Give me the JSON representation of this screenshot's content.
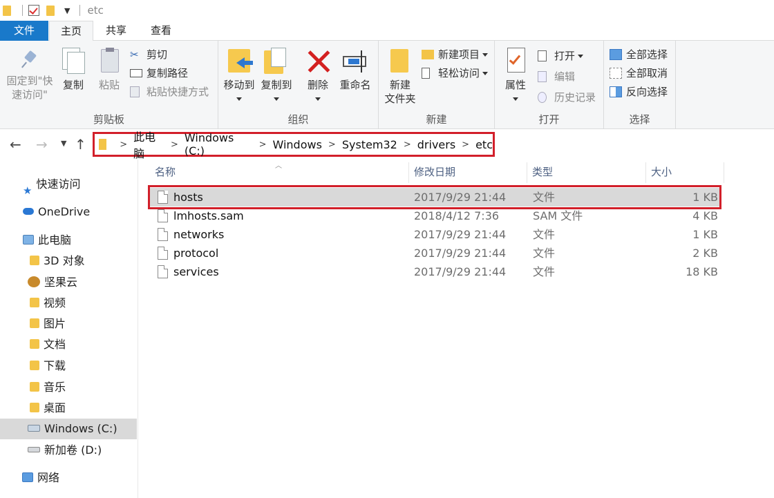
{
  "window": {
    "title": "etc"
  },
  "ribbon_tabs": {
    "file": "文件",
    "home": "主页",
    "share": "共享",
    "view": "查看"
  },
  "clipboard": {
    "label": "剪贴板",
    "pin_line1": "固定到\"快",
    "pin_line2": "速访问\"",
    "copy": "复制",
    "paste": "粘贴",
    "cut": "剪切",
    "copy_path": "复制路径",
    "paste_shortcut": "粘贴快捷方式"
  },
  "organize": {
    "label": "组织",
    "move_to": "移动到",
    "copy_to": "复制到",
    "delete": "删除",
    "rename": "重命名"
  },
  "new_group": {
    "label": "新建",
    "new_folder_line1": "新建",
    "new_folder_line2": "文件夹",
    "new_item": "新建项目",
    "easy_access": "轻松访问"
  },
  "open_group": {
    "label": "打开",
    "properties": "属性",
    "open": "打开",
    "edit": "编辑",
    "history": "历史记录"
  },
  "select_group": {
    "label": "选择",
    "select_all": "全部选择",
    "select_none": "全部取消",
    "invert": "反向选择"
  },
  "address": {
    "segments": [
      "此电脑",
      "Windows (C:)",
      "Windows",
      "System32",
      "drivers",
      "etc"
    ]
  },
  "sidebar": {
    "items": [
      "快速访问",
      "OneDrive",
      "此电脑",
      "3D 对象",
      "坚果云",
      "视频",
      "图片",
      "文档",
      "下载",
      "音乐",
      "桌面",
      "Windows (C:)",
      "新加卷 (D:)",
      "网络"
    ]
  },
  "columns": {
    "name": "名称",
    "date": "修改日期",
    "type": "类型",
    "size": "大小"
  },
  "files": [
    {
      "name": "hosts",
      "date": "2017/9/29 21:44",
      "type": "文件",
      "size": "1 KB"
    },
    {
      "name": "lmhosts.sam",
      "date": "2018/4/12 7:36",
      "type": "SAM 文件",
      "size": "4 KB"
    },
    {
      "name": "networks",
      "date": "2017/9/29 21:44",
      "type": "文件",
      "size": "1 KB"
    },
    {
      "name": "protocol",
      "date": "2017/9/29 21:44",
      "type": "文件",
      "size": "2 KB"
    },
    {
      "name": "services",
      "date": "2017/9/29 21:44",
      "type": "文件",
      "size": "18 KB"
    }
  ],
  "colors": {
    "accent": "#1979ca",
    "highlight_box": "#d21f2a",
    "selection": "#d9d9d9",
    "folder": "#f3c448"
  }
}
